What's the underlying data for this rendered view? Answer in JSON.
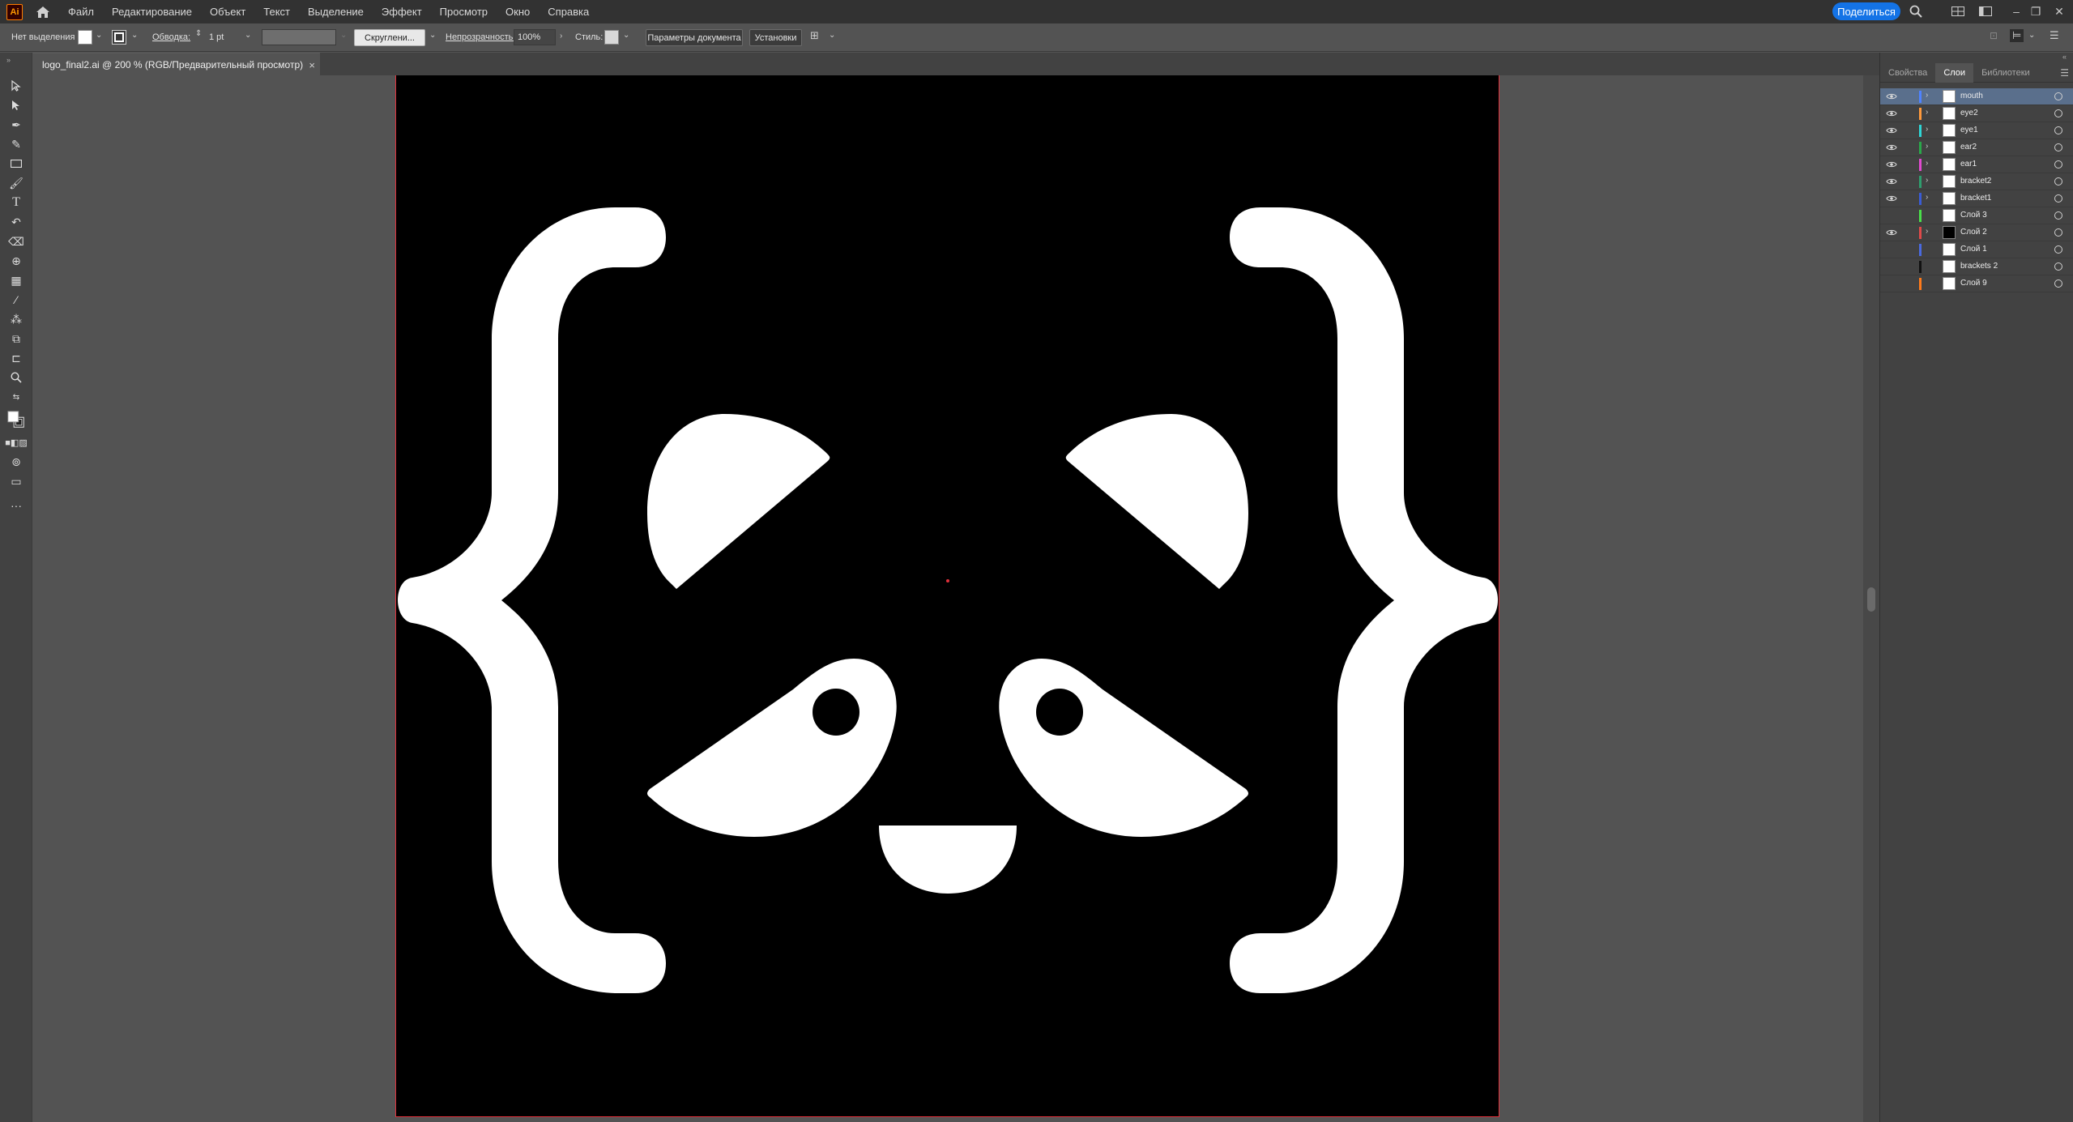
{
  "app": {
    "logo": "Ai",
    "menu": [
      "Файл",
      "Редактирование",
      "Объект",
      "Текст",
      "Выделение",
      "Эффект",
      "Просмотр",
      "Окно",
      "Справка"
    ],
    "share_label": "Поделиться"
  },
  "control_bar": {
    "selection_label": "Нет выделения",
    "stroke_label": "Обводка:",
    "stroke_value": "1 pt",
    "brush_label": "Скруглени...",
    "opacity_label": "Непрозрачность:",
    "opacity_value": "100%",
    "style_label": "Стиль:",
    "doc_setup_button": "Параметры документа",
    "prefs_button": "Установки"
  },
  "document": {
    "tab_title": "logo_final2.ai @ 200 % (RGB/Предварительный просмотр)",
    "close_glyph": "×"
  },
  "panels": {
    "tabs": [
      "Свойства",
      "Слои",
      "Библиотеки"
    ],
    "active_tab": "Слои",
    "layers": [
      {
        "name": "mouth",
        "color": "#4f83ff",
        "visible": true,
        "expandable": true,
        "selected": true,
        "thumb": "#ffffff"
      },
      {
        "name": "eye2",
        "color": "#ff9a3c",
        "visible": true,
        "expandable": true,
        "selected": false,
        "thumb": "#ffffff"
      },
      {
        "name": "eye1",
        "color": "#2fd6d6",
        "visible": true,
        "expandable": true,
        "selected": false,
        "thumb": "#ffffff"
      },
      {
        "name": "ear2",
        "color": "#2aa84a",
        "visible": true,
        "expandable": true,
        "selected": false,
        "thumb": "#ffffff"
      },
      {
        "name": "ear1",
        "color": "#e04ad0",
        "visible": true,
        "expandable": true,
        "selected": false,
        "thumb": "#ffffff"
      },
      {
        "name": "bracket2",
        "color": "#2f9e6e",
        "visible": true,
        "expandable": true,
        "selected": false,
        "thumb": "#ffffff"
      },
      {
        "name": "bracket1",
        "color": "#3a5cd6",
        "visible": true,
        "expandable": true,
        "selected": false,
        "thumb": "#ffffff"
      },
      {
        "name": "Слой 3",
        "color": "#4adf4a",
        "visible": false,
        "expandable": false,
        "selected": false,
        "thumb": "#ffffff"
      },
      {
        "name": "Слой 2",
        "color": "#e04a4a",
        "visible": true,
        "expandable": true,
        "selected": false,
        "thumb": "#000000"
      },
      {
        "name": "Слой 1",
        "color": "#4a6ae0",
        "visible": false,
        "expandable": false,
        "selected": false,
        "thumb": "#ffffff"
      },
      {
        "name": "brackets 2",
        "color": "#111111",
        "visible": false,
        "expandable": false,
        "selected": false,
        "thumb": "#ffffff"
      },
      {
        "name": "Слой 9",
        "color": "#ff7a1a",
        "visible": false,
        "expandable": false,
        "selected": false,
        "thumb": "#ffffff"
      }
    ]
  },
  "colors": {
    "accent": "#1473e6",
    "artboard": "#000000",
    "artwork": "#ffffff",
    "artboard_border": "#e0303a"
  }
}
